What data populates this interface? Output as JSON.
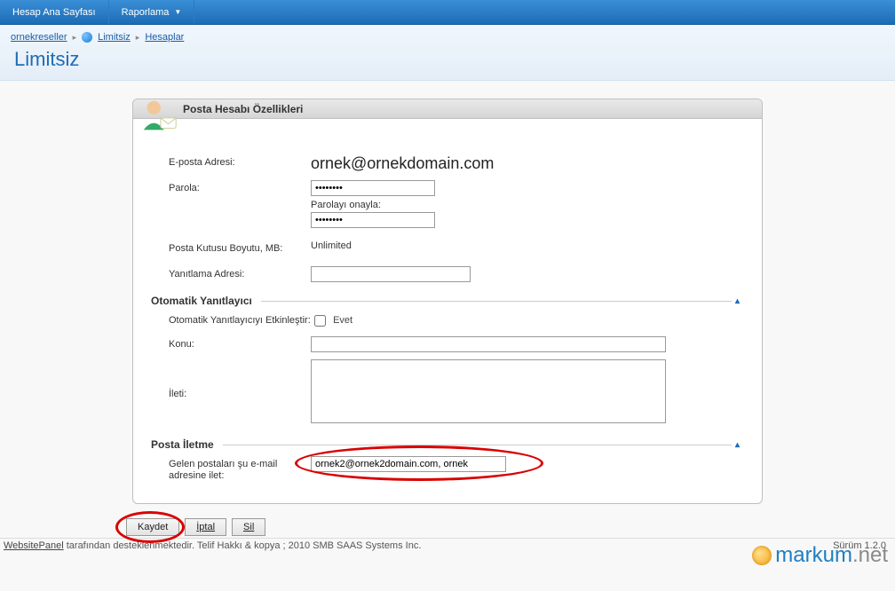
{
  "topnav": {
    "home": "Hesap Ana Sayfası",
    "reporting": "Raporlama"
  },
  "breadcrumb": {
    "reseller": "ornekreseller",
    "limitless": "Limitsiz",
    "accounts": "Hesaplar"
  },
  "page_title": "Limitsiz",
  "panel_title": "Posta Hesabı Özellikleri",
  "labels": {
    "email": "E-posta Adresi:",
    "password": "Parola:",
    "confirm_password": "Parolayı onayla:",
    "mailbox_size": "Posta Kutusu Boyutu, MB:",
    "reply_to": "Yanıtlama Adresi:",
    "autoresponder_section": "Otomatik Yanıtlayıcı",
    "autoresponder_enable": "Otomatik Yanıtlayıcıyı Etkinleştir:",
    "yes": "Evet",
    "subject": "Konu:",
    "message": "İleti:",
    "forwarding_section": "Posta İletme",
    "forward_to": "Gelen postaları şu e-mail adresine ilet:"
  },
  "values": {
    "email": "ornek@ornekdomain.com",
    "password": "••••••••",
    "confirm_password": "••••••••",
    "mailbox_size": "Unlimited",
    "reply_to": "",
    "autoresponder_enabled": false,
    "subject": "",
    "message": "",
    "forward_to": "ornek2@ornek2domain.com, ornek"
  },
  "buttons": {
    "save": "Kaydet",
    "cancel": "İptal",
    "delete": "Sil"
  },
  "footer": {
    "powered_link": "WebsitePanel",
    "powered_text": " tarafından desteklenmektedir. Telif Hakkı & kopya ; 2010 SMB SAAS Systems Inc.",
    "version": "Sürüm 1.2.0"
  },
  "logo": {
    "part1": "markum",
    "part2": ".net"
  }
}
